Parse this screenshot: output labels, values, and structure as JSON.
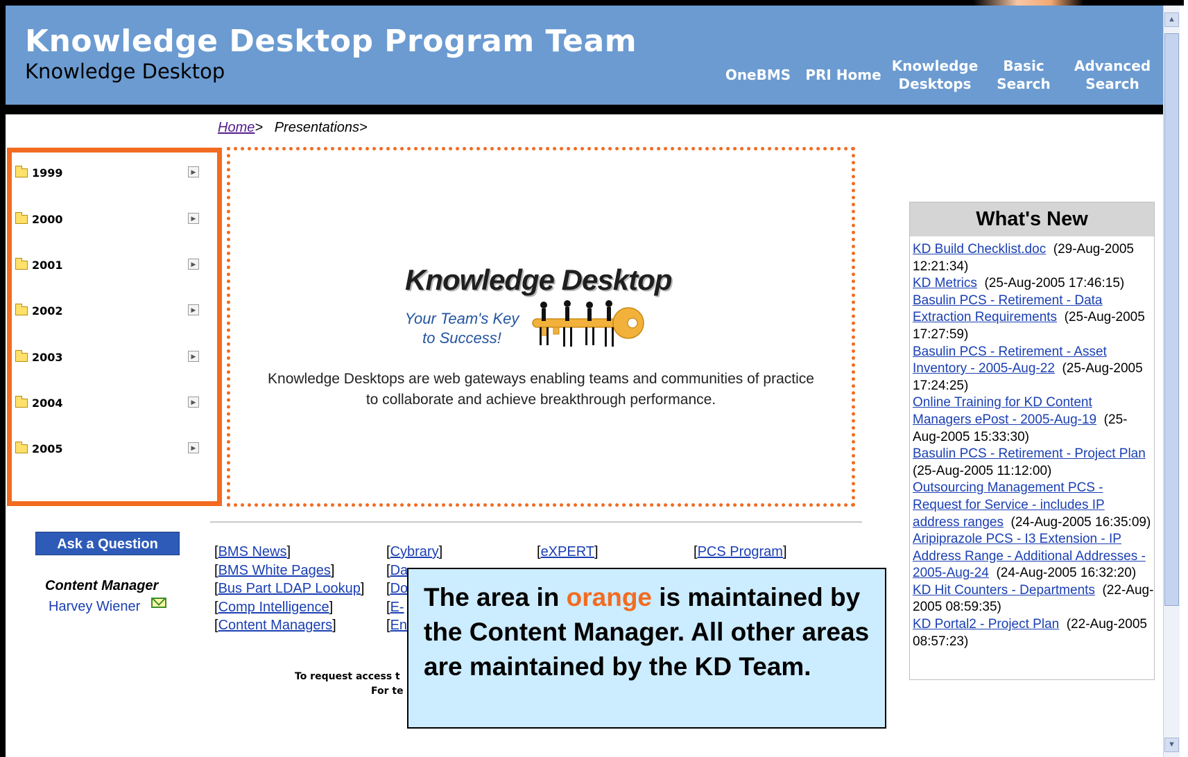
{
  "header": {
    "title": "Knowledge Desktop Program Team",
    "subtitle": "Knowledge Desktop",
    "nav": [
      {
        "line1": "OneBMS",
        "line2": ""
      },
      {
        "line1": "PRI Home",
        "line2": ""
      },
      {
        "line1": "Knowledge",
        "line2": "Desktops"
      },
      {
        "line1": "Basic",
        "line2": "Search"
      },
      {
        "line1": "Advanced",
        "line2": "Search"
      }
    ]
  },
  "breadcrumb": {
    "home": "Home",
    "sep1": ">",
    "current": "Presentations",
    "sep2": ">"
  },
  "years": [
    "1999",
    "2000",
    "2001",
    "2002",
    "2003",
    "2004",
    "2005"
  ],
  "main": {
    "logo_title": "Knowledge Desktop",
    "logo_tagline_1": "Your Team's Key",
    "logo_tagline_2": "to Success!",
    "description": "Knowledge Desktops are web gateways enabling teams and communities of practice to collaborate and achieve breakthrough performance."
  },
  "sidebar_bottom": {
    "ask_label": "Ask a Question",
    "content_manager_label": "Content Manager",
    "content_manager_name": "Harvey Wiener"
  },
  "links": {
    "col1": [
      "BMS News",
      "BMS White Pages",
      "Bus Part LDAP Lookup",
      "Comp Intelligence",
      "Content Managers"
    ],
    "col2": [
      "Cybrary",
      "Da",
      "Do",
      "E-",
      "En"
    ],
    "col3": [
      "eXPERT"
    ],
    "col4": [
      "PCS Program"
    ]
  },
  "footer": {
    "line1": "To request access t",
    "line2": "For te"
  },
  "callout": {
    "part1": "The area in ",
    "highlight": "orange",
    "part2": " is maintained by the Content Manager.  All other areas are maintained by the KD Team."
  },
  "whats_new": {
    "title": "What's New",
    "items": [
      {
        "link": "KD Build Checklist.doc",
        "date": "(29-Aug-2005 12:21:34)"
      },
      {
        "link": "KD Metrics",
        "date": "(25-Aug-2005 17:46:15)"
      },
      {
        "link": "Basulin PCS - Retirement - Data Extraction Requirements",
        "date": "(25-Aug-2005 17:27:59)"
      },
      {
        "link": "Basulin PCS - Retirement - Asset Inventory - 2005-Aug-22",
        "date": "(25-Aug-2005 17:24:25)"
      },
      {
        "link": "Online Training for KD Content Managers ePost - 2005-Aug-19",
        "date": "(25-Aug-2005 15:33:30)"
      },
      {
        "link": "Basulin PCS - Retirement - Project Plan",
        "date": "(25-Aug-2005 11:12:00)"
      },
      {
        "link": "Outsourcing Management PCS - Request for Service - includes IP address ranges",
        "date": "(24-Aug-2005 16:35:09)"
      },
      {
        "link": "Aripiprazole PCS - I3 Extension - IP Address Range - Additional Addresses - 2005-Aug-24",
        "date": "(24-Aug-2005 16:32:20)"
      },
      {
        "link": "KD Hit Counters - Departments",
        "date": "(22-Aug-2005 08:59:35)"
      },
      {
        "link": "KD Portal2 - Project Plan",
        "date": "(22-Aug-2005 08:57:23)"
      }
    ]
  },
  "colors": {
    "header_bg": "#6b9bd1",
    "accent_orange": "#f26b21",
    "link_blue": "#1a3fb3",
    "callout_bg": "#ccecff"
  }
}
